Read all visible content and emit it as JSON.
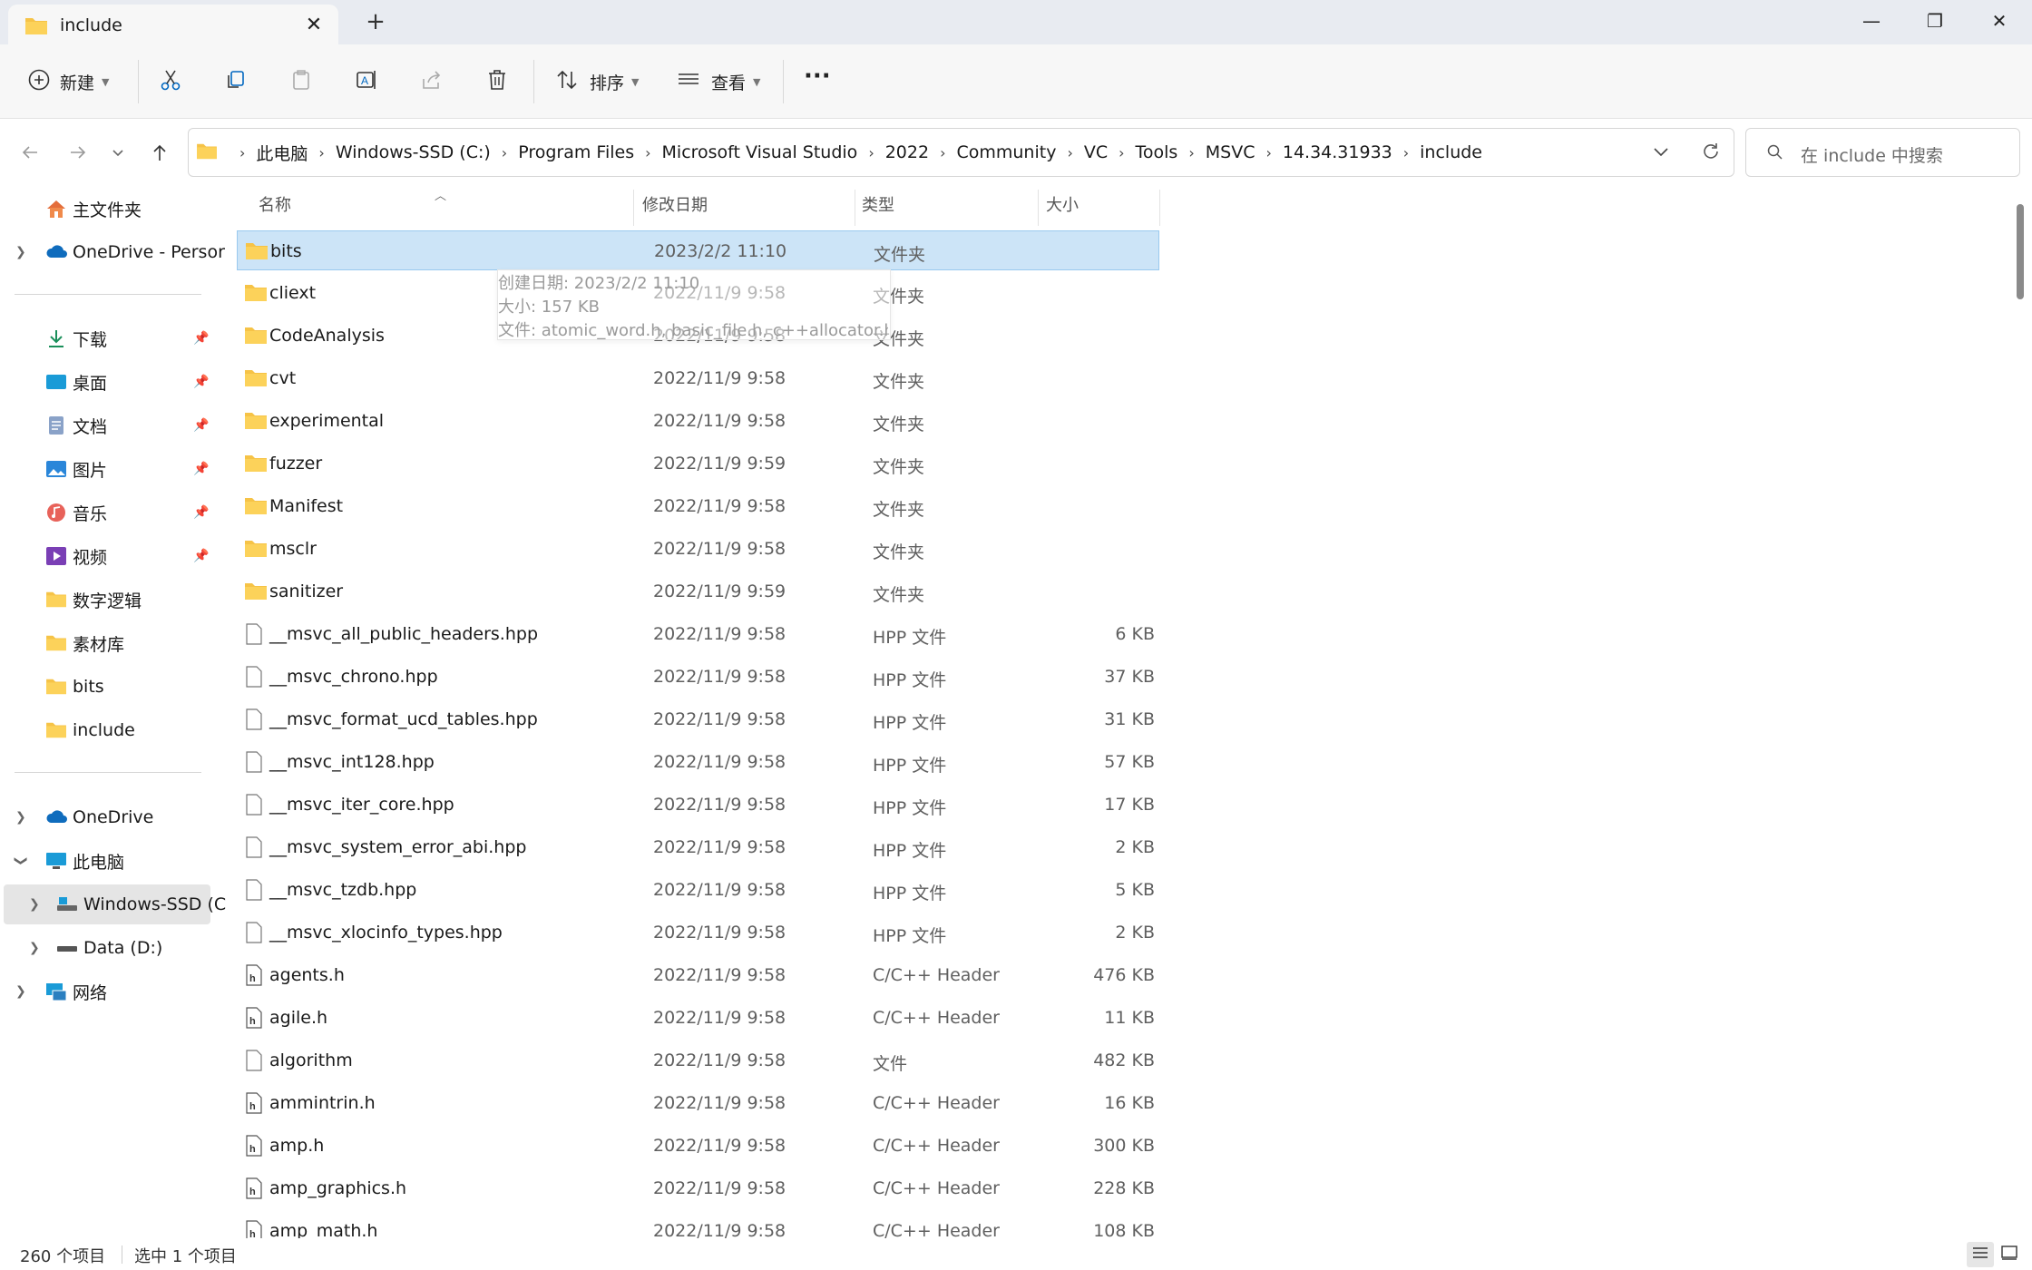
{
  "window": {
    "tab_title": "include",
    "new_tab": "+",
    "close_tab": "✕",
    "minimize": "—",
    "maximize": "❐",
    "close": "✕"
  },
  "toolbar": {
    "new_label": "新建",
    "sort_label": "排序",
    "view_label": "查看",
    "more": "···"
  },
  "address": {
    "crumbs": [
      "此电脑",
      "Windows-SSD (C:)",
      "Program Files",
      "Microsoft Visual Studio",
      "2022",
      "Community",
      "VC",
      "Tools",
      "MSVC",
      "14.34.31933",
      "include"
    ],
    "search_placeholder": "在 include 中搜索"
  },
  "sidebar": {
    "items": [
      {
        "label": "主文件夹",
        "icon": "home-icon"
      },
      {
        "label": "OneDrive - Persor",
        "icon": "cloud-icon"
      },
      {
        "label": "下载",
        "icon": "download-icon"
      },
      {
        "label": "桌面",
        "icon": "desktop-icon"
      },
      {
        "label": "文档",
        "icon": "document-icon"
      },
      {
        "label": "图片",
        "icon": "pictures-icon"
      },
      {
        "label": "音乐",
        "icon": "music-icon"
      },
      {
        "label": "视频",
        "icon": "video-icon"
      },
      {
        "label": "数字逻辑",
        "icon": "folder-icon"
      },
      {
        "label": "素材库",
        "icon": "folder-icon"
      },
      {
        "label": "bits",
        "icon": "folder-icon"
      },
      {
        "label": "include",
        "icon": "folder-icon"
      },
      {
        "label": "OneDrive",
        "icon": "cloud-icon"
      },
      {
        "label": "此电脑",
        "icon": "computer-icon"
      },
      {
        "label": "Windows-SSD (C",
        "icon": "drive-icon"
      },
      {
        "label": "Data (D:)",
        "icon": "drive-icon"
      },
      {
        "label": "网络",
        "icon": "network-icon"
      }
    ]
  },
  "columns": {
    "name": "名称",
    "modified": "修改日期",
    "type": "类型",
    "size": "大小"
  },
  "files": [
    {
      "name": "bits",
      "date": "2023/2/2 11:10",
      "type": "文件夹",
      "size": "",
      "kind": "folder"
    },
    {
      "name": "cliext",
      "date": "2022/11/9 9:58",
      "type": "文件夹",
      "size": "",
      "kind": "folder"
    },
    {
      "name": "CodeAnalysis",
      "date": "2022/11/9 9:58",
      "type": "文件夹",
      "size": "",
      "kind": "folder"
    },
    {
      "name": "cvt",
      "date": "2022/11/9 9:58",
      "type": "文件夹",
      "size": "",
      "kind": "folder"
    },
    {
      "name": "experimental",
      "date": "2022/11/9 9:58",
      "type": "文件夹",
      "size": "",
      "kind": "folder"
    },
    {
      "name": "fuzzer",
      "date": "2022/11/9 9:59",
      "type": "文件夹",
      "size": "",
      "kind": "folder"
    },
    {
      "name": "Manifest",
      "date": "2022/11/9 9:58",
      "type": "文件夹",
      "size": "",
      "kind": "folder"
    },
    {
      "name": "msclr",
      "date": "2022/11/9 9:58",
      "type": "文件夹",
      "size": "",
      "kind": "folder"
    },
    {
      "name": "sanitizer",
      "date": "2022/11/9 9:59",
      "type": "文件夹",
      "size": "",
      "kind": "folder"
    },
    {
      "name": "__msvc_all_public_headers.hpp",
      "date": "2022/11/9 9:58",
      "type": "HPP 文件",
      "size": "6 KB",
      "kind": "file"
    },
    {
      "name": "__msvc_chrono.hpp",
      "date": "2022/11/9 9:58",
      "type": "HPP 文件",
      "size": "37 KB",
      "kind": "file"
    },
    {
      "name": "__msvc_format_ucd_tables.hpp",
      "date": "2022/11/9 9:58",
      "type": "HPP 文件",
      "size": "31 KB",
      "kind": "file"
    },
    {
      "name": "__msvc_int128.hpp",
      "date": "2022/11/9 9:58",
      "type": "HPP 文件",
      "size": "57 KB",
      "kind": "file"
    },
    {
      "name": "__msvc_iter_core.hpp",
      "date": "2022/11/9 9:58",
      "type": "HPP 文件",
      "size": "17 KB",
      "kind": "file"
    },
    {
      "name": "__msvc_system_error_abi.hpp",
      "date": "2022/11/9 9:58",
      "type": "HPP 文件",
      "size": "2 KB",
      "kind": "file"
    },
    {
      "name": "__msvc_tzdb.hpp",
      "date": "2022/11/9 9:58",
      "type": "HPP 文件",
      "size": "5 KB",
      "kind": "file"
    },
    {
      "name": "__msvc_xlocinfo_types.hpp",
      "date": "2022/11/9 9:58",
      "type": "HPP 文件",
      "size": "2 KB",
      "kind": "file"
    },
    {
      "name": "agents.h",
      "date": "2022/11/9 9:58",
      "type": "C/C++ Header",
      "size": "476 KB",
      "kind": "header"
    },
    {
      "name": "agile.h",
      "date": "2022/11/9 9:58",
      "type": "C/C++ Header",
      "size": "11 KB",
      "kind": "header"
    },
    {
      "name": "algorithm",
      "date": "2022/11/9 9:58",
      "type": "文件",
      "size": "482 KB",
      "kind": "file"
    },
    {
      "name": "ammintrin.h",
      "date": "2022/11/9 9:58",
      "type": "C/C++ Header",
      "size": "16 KB",
      "kind": "header"
    },
    {
      "name": "amp.h",
      "date": "2022/11/9 9:58",
      "type": "C/C++ Header",
      "size": "300 KB",
      "kind": "header"
    },
    {
      "name": "amp_graphics.h",
      "date": "2022/11/9 9:58",
      "type": "C/C++ Header",
      "size": "228 KB",
      "kind": "header"
    },
    {
      "name": "amp_math.h",
      "date": "2022/11/9 9:58",
      "type": "C/C++ Header",
      "size": "108 KB",
      "kind": "header"
    }
  ],
  "tooltip": {
    "line1": "创建日期: 2023/2/2 11:10",
    "line2": "大小: 157 KB",
    "line3": "文件: atomic_word.h, basic_file.h, c++allocator.h, ..."
  },
  "status": {
    "count": "260 个项目",
    "selected": "选中 1 个项目"
  },
  "colors": {
    "selection": "#cce4f7",
    "selection_border": "#99c9ef",
    "folder": "#f6c347",
    "accent": "#0067c0"
  }
}
